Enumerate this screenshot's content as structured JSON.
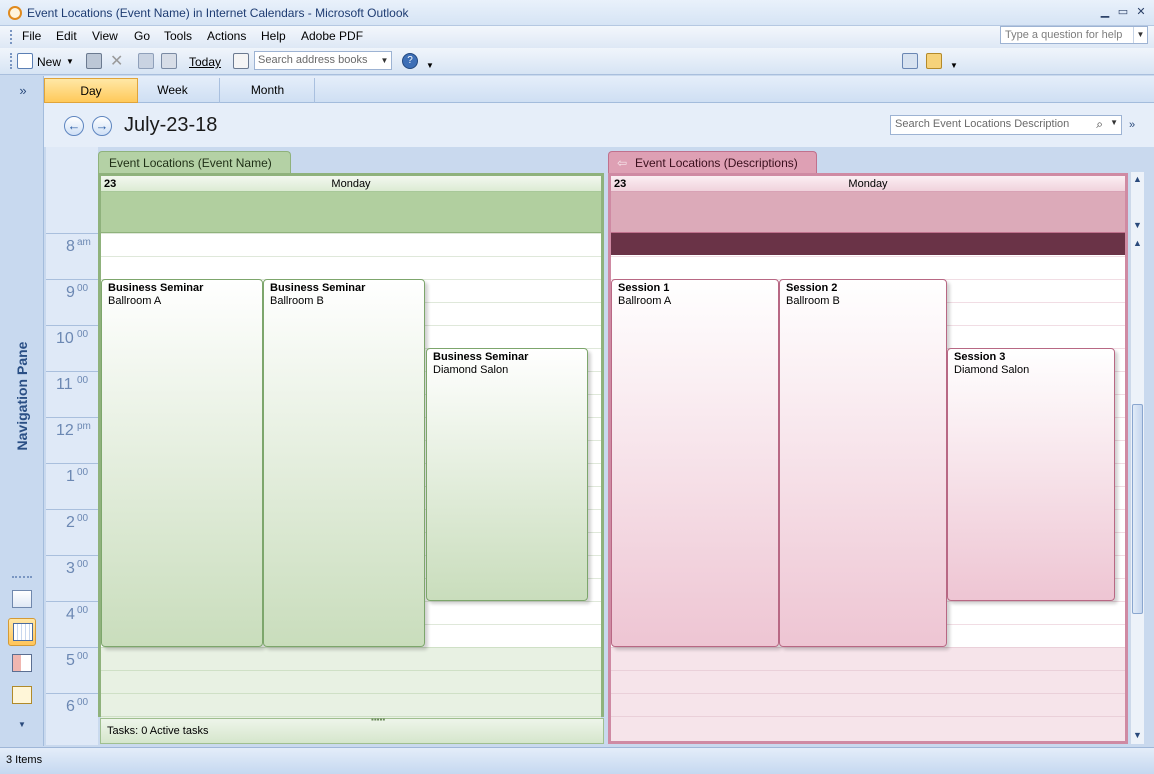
{
  "window": {
    "title_prefix": "Event Locations (Event Name) in Internet Calendars - ",
    "title_app": "Microsoft Outlook"
  },
  "menu": [
    "File",
    "Edit",
    "View",
    "Go",
    "Tools",
    "Actions",
    "Help",
    "Adobe PDF"
  ],
  "help_placeholder": "Type a question for help",
  "toolbar": {
    "new_label": "New",
    "today_label": "Today",
    "address_placeholder": "Search address books"
  },
  "navpane": {
    "expand": "»",
    "label": "Navigation Pane"
  },
  "view_tabs": [
    "Day",
    "Week",
    "Month"
  ],
  "active_view": "Day",
  "date_title": "July-23-18",
  "search_placeholder": "Search Event Locations Description",
  "hours": [
    {
      "h": "8",
      "m": "am"
    },
    {
      "h": "9",
      "m": "00"
    },
    {
      "h": "10",
      "m": "00"
    },
    {
      "h": "11",
      "m": "00"
    },
    {
      "h": "12",
      "m": "pm"
    },
    {
      "h": "1",
      "m": "00"
    },
    {
      "h": "2",
      "m": "00"
    },
    {
      "h": "3",
      "m": "00"
    },
    {
      "h": "4",
      "m": "00"
    },
    {
      "h": "5",
      "m": "00"
    },
    {
      "h": "6",
      "m": "00"
    }
  ],
  "calendars": [
    {
      "name": "Event Locations (Event Name)",
      "day_number": "23",
      "day_name": "Monday",
      "color": "#8fb27c",
      "events": [
        {
          "title": "Business Seminar",
          "location": "Ballroom A",
          "start": "9:00",
          "end": "17:00"
        },
        {
          "title": "Business Seminar",
          "location": "Ballroom B",
          "start": "9:00",
          "end": "17:00"
        },
        {
          "title": "Business Seminar",
          "location": "Diamond Salon",
          "start": "10:30",
          "end": "16:00"
        }
      ],
      "tasks": "Tasks: 0 Active tasks"
    },
    {
      "name": "Event Locations (Descriptions)",
      "day_number": "23",
      "day_name": "Monday",
      "color": "#cf8aa3",
      "events": [
        {
          "title": "Session 1",
          "location": "Ballroom A",
          "start": "9:00",
          "end": "17:00"
        },
        {
          "title": "Session 2",
          "location": "Ballroom B",
          "start": "9:00",
          "end": "17:00"
        },
        {
          "title": "Session 3",
          "location": "Diamond Salon",
          "start": "10:30",
          "end": "16:00"
        }
      ]
    }
  ],
  "status": "3 Items",
  "icons": {
    "app": "outlook-icon",
    "print": "print-icon",
    "delete": "delete-icon",
    "address_book": "address-book-icon",
    "help": "help-icon",
    "mail": "mail-icon",
    "calendar": "calendar-icon",
    "contacts": "contacts-icon",
    "tasks": "tasks-icon"
  }
}
